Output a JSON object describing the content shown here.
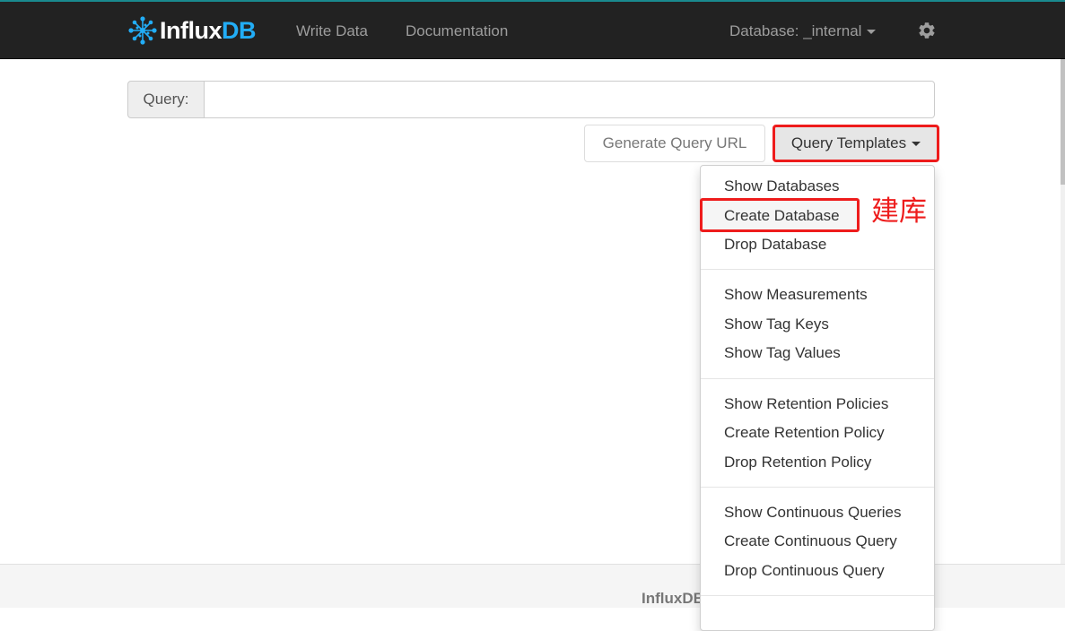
{
  "navbar": {
    "brand_part1": "Influx",
    "brand_part2": "DB",
    "write_data": "Write Data",
    "documentation": "Documentation",
    "database_label": "Database: _internal",
    "logo_icon": "influxdb-logo-icon",
    "settings_icon": "gear-icon"
  },
  "query": {
    "label": "Query:",
    "value": "",
    "placeholder": ""
  },
  "buttons": {
    "generate_url": "Generate Query URL",
    "templates": "Query Templates"
  },
  "dropdown": {
    "groups": [
      [
        "Show Databases",
        "Create Database",
        "Drop Database"
      ],
      [
        "Show Measurements",
        "Show Tag Keys",
        "Show Tag Values"
      ],
      [
        "Show Retention Policies",
        "Create Retention Policy",
        "Drop Retention Policy"
      ],
      [
        "Show Continuous Queries",
        "Create Continuous Query",
        "Drop Continuous Query"
      ]
    ]
  },
  "annotation": {
    "text": "建库",
    "color": "#ee1c1c"
  },
  "footer": {
    "text": "InfluxDB"
  },
  "colors": {
    "navbar_bg": "#222222",
    "brand_accent": "#22adf6",
    "highlight_red": "#ee1c1c"
  }
}
